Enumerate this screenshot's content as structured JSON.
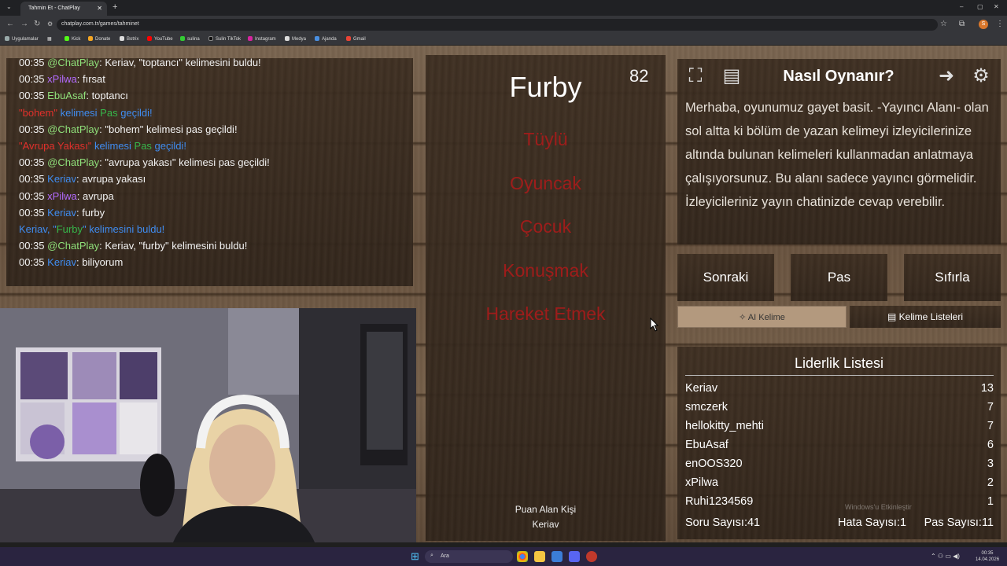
{
  "browser": {
    "tab_title": "Tahmin Et - ChatPlay",
    "url": "chatplay.com.tr/games/tahminet",
    "bookmarks": [
      "Uygulamalar",
      "Kick",
      "Donate",
      "Botrix",
      "YouTube",
      "sulina",
      "Sulin TikTok",
      "Instagram",
      "Medya",
      "Ajanda",
      "Gmail"
    ]
  },
  "chat": [
    {
      "time": "00:35",
      "user": "@ChatPlay",
      "user_color": "#8fe07a",
      "sep": ": ",
      "msg": "Keriav, \"toptancı\" kelimesini buldu!",
      "msg_color": "#f2f2f2"
    },
    {
      "time": "00:35",
      "user": "xPilwa",
      "user_color": "#b36bff",
      "sep": ": ",
      "msg": "fırsat",
      "msg_color": "#f2f2f2"
    },
    {
      "time": "00:35",
      "user": "EbuAsaf",
      "user_color": "#8fe07a",
      "sep": ": ",
      "msg": "toptancı",
      "msg_color": "#f2f2f2"
    },
    {
      "time": "",
      "user": "\"bohem\"",
      "user_color": "#e0302b",
      "sep": " kelimesi ",
      "msg": "Pas",
      "msg_color": "#36b64a",
      "extra": " geçildi!"
    },
    {
      "time": "00:35",
      "user": "@ChatPlay",
      "user_color": "#8fe07a",
      "sep": ": ",
      "msg": "\"bohem\" kelimesi pas geçildi!",
      "msg_color": "#f2f2f2"
    },
    {
      "time": "",
      "user": "\"Avrupa Yakası\"",
      "user_color": "#e0302b",
      "sep": " kelimesi ",
      "msg": "Pas",
      "msg_color": "#36b64a",
      "extra": " geçildi!"
    },
    {
      "time": "00:35",
      "user": "@ChatPlay",
      "user_color": "#8fe07a",
      "sep": ": ",
      "msg": "\"avrupa yakası\" kelimesi pas geçildi!",
      "msg_color": "#f2f2f2"
    },
    {
      "time": "00:35",
      "user": "Keriav",
      "user_color": "#3f8cf0",
      "sep": ": ",
      "msg": "avrupa yakası",
      "msg_color": "#f2f2f2"
    },
    {
      "time": "00:35",
      "user": "xPilwa",
      "user_color": "#b36bff",
      "sep": ": ",
      "msg": "avrupa",
      "msg_color": "#f2f2f2"
    },
    {
      "time": "00:35",
      "user": "Keriav",
      "user_color": "#3f8cf0",
      "sep": ": ",
      "msg": "furby",
      "msg_color": "#f2f2f2"
    },
    {
      "time": "",
      "user": "Keriav, \"",
      "user_color": "#3f8cf0",
      "sep": "",
      "msg": "Furby",
      "msg_color": "#36b64a",
      "extra": "\" kelimesini buldu!"
    },
    {
      "time": "00:35",
      "user": "@ChatPlay",
      "user_color": "#8fe07a",
      "sep": ": ",
      "msg": "Keriav, \"furby\" kelimesini buldu!",
      "msg_color": "#f2f2f2"
    },
    {
      "time": "00:35",
      "user": "Keriav",
      "user_color": "#3f8cf0",
      "sep": ": ",
      "msg": "biliyorum",
      "msg_color": "#f2f2f2"
    }
  ],
  "game": {
    "timer": "82",
    "word": "Furby",
    "forbidden": [
      "Tüylü",
      "Oyuncak",
      "Çocuk",
      "Konuşmak",
      "Hareket Etmek"
    ],
    "scorer_label": "Puan Alan Kişi",
    "scorer_name": "Keriav"
  },
  "help": {
    "title": "Nasıl Oynanır?",
    "text": "Merhaba, oyunumuz gayet basit. -Yayıncı Alanı- olan sol altta ki bölüm de yazan kelimeyi izleyicilerinize altında bulunan kelimeleri kullanmadan anlatmaya çalışıyorsunuz. Bu alanı sadece yayıncı görmelidir. İzleyicileriniz yayın chatinizde cevap verebilir."
  },
  "controls": {
    "next": "Sonraki",
    "pass": "Pas",
    "reset": "Sıfırla",
    "ai_word": "AI Kelime",
    "word_lists": "Kelime Listeleri"
  },
  "leaderboard": {
    "title": "Liderlik Listesi",
    "rows": [
      {
        "name": "Keriav",
        "score": "13"
      },
      {
        "name": "smczerk",
        "score": "7"
      },
      {
        "name": "hellokitty_mehti",
        "score": "7"
      },
      {
        "name": "EbuAsaf",
        "score": "6"
      },
      {
        "name": "enOOS320",
        "score": "3"
      },
      {
        "name": "xPilwa",
        "score": "2"
      },
      {
        "name": "Ruhi1234569",
        "score": "1"
      }
    ],
    "questions": "Soru Sayısı:41",
    "errors": "Hata Sayısı:1",
    "passes": "Pas Sayısı:11"
  },
  "watermark": "Windows'u Etkinleştir",
  "taskbar": {
    "search": "Ara",
    "time": "00:35",
    "date": "14.04.2026"
  }
}
